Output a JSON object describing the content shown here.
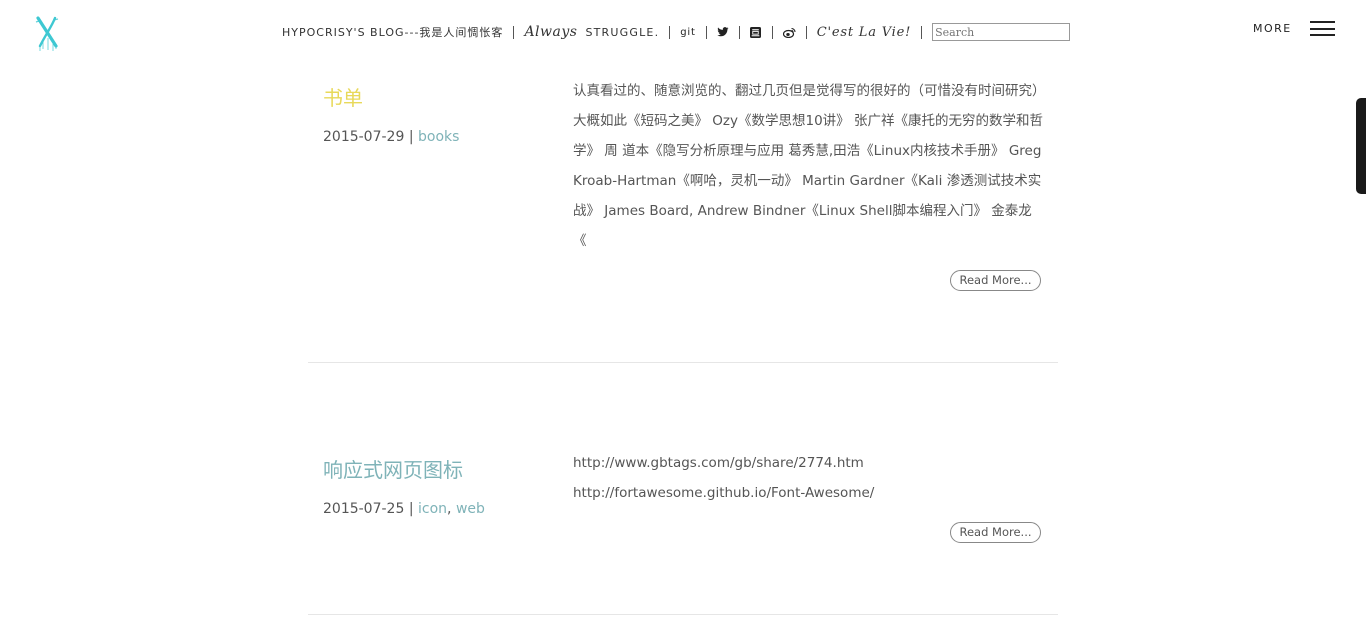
{
  "header": {
    "blog_name": "HYPOCRISY'S BLOG---我是人间惆怅客",
    "motto_italic": "Always",
    "motto_caps": "STRUGGLE.",
    "git_label": "git",
    "twitter_icon": "twitter-icon",
    "douban_icon": "douban-icon",
    "weibo_icon": "weibo-icon",
    "cest": "C'est La Vie!",
    "search_placeholder": "Search",
    "more_label": "MORE"
  },
  "colors": {
    "title_yellow": "#e8d95a",
    "title_teal": "#7fb3b8",
    "tag_teal": "#7fb3b8",
    "logo_cyan": "#3ec8d2"
  },
  "posts": [
    {
      "title": "书单",
      "date": "2015-07-29",
      "meta_sep": " | ",
      "tags": [
        "books"
      ],
      "excerpt": "认真看过的、随意浏览的、翻过几页但是觉得写的很好的（可惜没有时间研究）大概如此《短码之美》 Ozy《数学思想10讲》 张广祥《康托的无穷的数学和哲学》 周 道本《隐写分析原理与应用 葛秀慧,田浩《Linux内核技术手册》 Greg Kroab-Hartman《啊哈，灵机一动》 Martin Gardner《Kali 渗透测试技术实战》 James Board, Andrew Bindner《Linux Shell脚本编程入门》 金泰龙《",
      "read_more": "Read More..."
    },
    {
      "title": "响应式网页图标",
      "date": "2015-07-25",
      "meta_sep": " | ",
      "tags": [
        "icon",
        "web"
      ],
      "tag_sep": ", ",
      "excerpt_lines": [
        "http://www.gbtags.com/gb/share/2774.htm",
        "http://fortawesome.github.io/Font-Awesome/"
      ],
      "read_more": "Read More..."
    }
  ]
}
